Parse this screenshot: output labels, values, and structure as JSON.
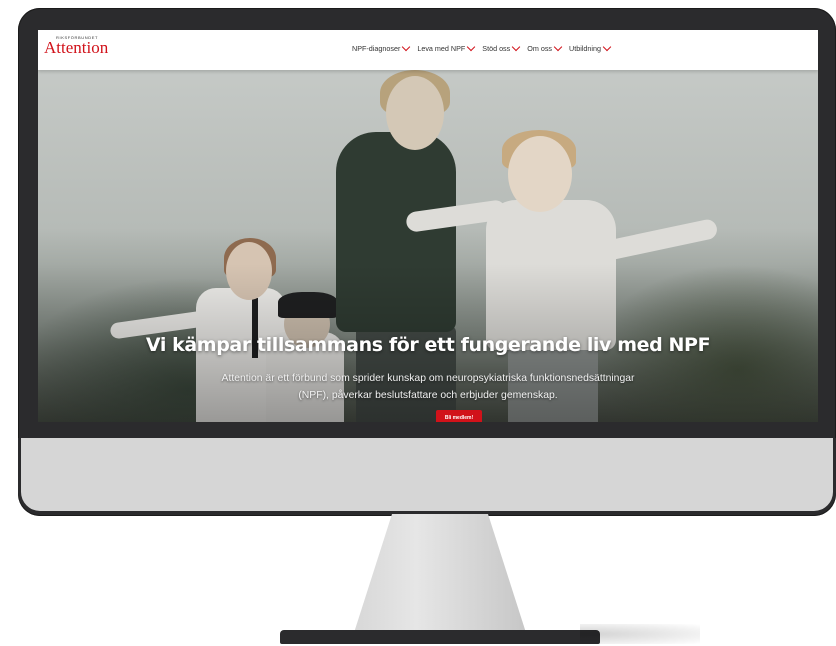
{
  "logo": {
    "small": "RIKSFÖRBUNDET",
    "main": "Attention"
  },
  "nav": [
    {
      "label": "NPF-diagnoser"
    },
    {
      "label": "Leva med NPF"
    },
    {
      "label": "Stöd oss"
    },
    {
      "label": "Om oss"
    },
    {
      "label": "Utbildning"
    }
  ],
  "hero": {
    "title": "Vi kämpar tillsammans för ett fungerande liv med NPF",
    "description": "Attention är ett förbund som sprider kunskap om neuropsykiatriska funktionsnedsättningar (NPF), påverkar beslutsfattare och erbjuder gemenskap.",
    "cta": "Bli medlem!"
  },
  "colors": {
    "brand_red": "#d1121a",
    "bezel": "#2b2b2d",
    "chin": "#d6d6d6"
  },
  "icons": {
    "nav_dropdown": "chevron-down-icon"
  }
}
